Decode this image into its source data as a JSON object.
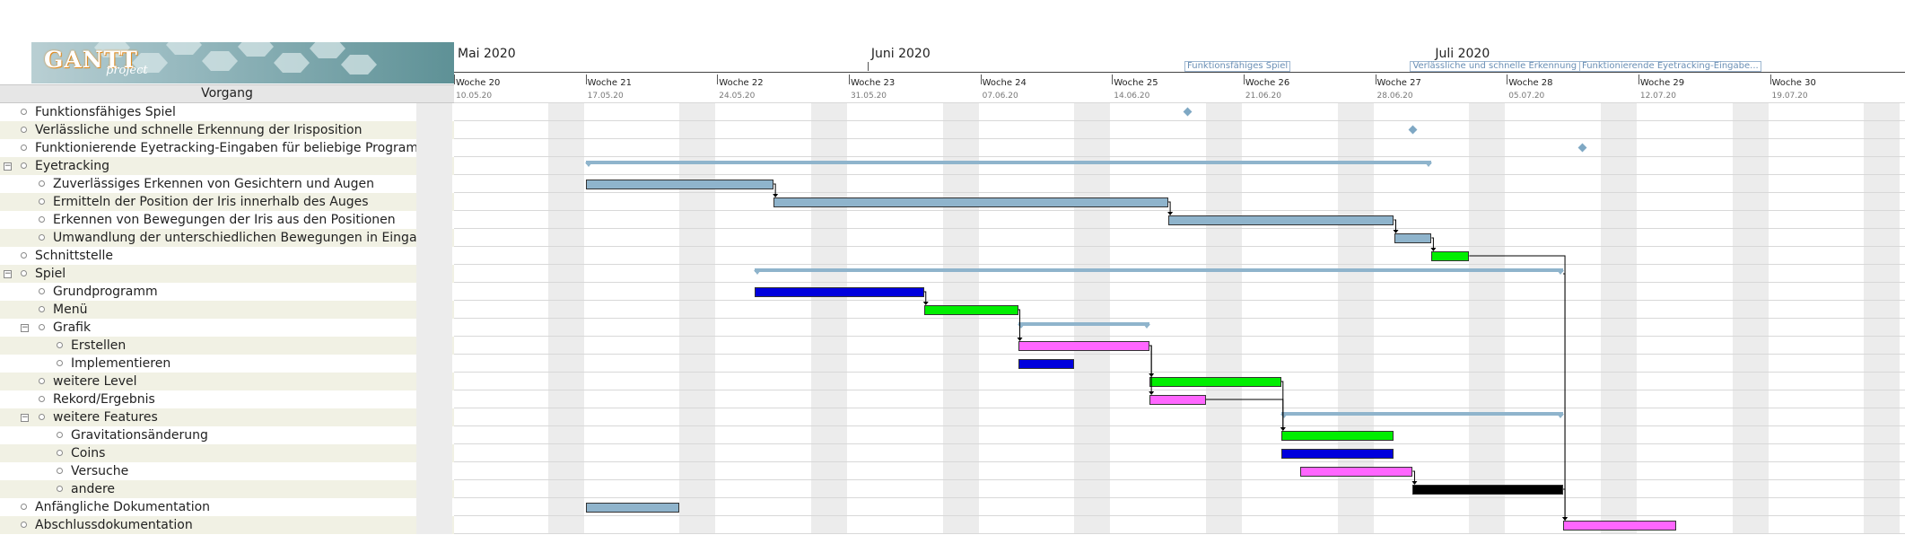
{
  "header": {
    "logo_text": "GANTT",
    "logo_sub": "project",
    "column_title": "Vorgang"
  },
  "months": [
    {
      "label": "Mai 2020"
    },
    {
      "label": "Juni 2020"
    },
    {
      "label": "Juli 2020"
    }
  ],
  "milestone_labels": [
    "Funktionsfähiges Spiel",
    "Verlässliche und schnelle Erkennung ...",
    "Funktionierende Eyetracking-Eingabe..."
  ],
  "weeks": [
    {
      "label": "Woche 20",
      "date": "10.05.20"
    },
    {
      "label": "Woche 21",
      "date": "17.05.20"
    },
    {
      "label": "Woche 22",
      "date": "24.05.20"
    },
    {
      "label": "Woche 23",
      "date": "31.05.20"
    },
    {
      "label": "Woche 24",
      "date": "07.06.20"
    },
    {
      "label": "Woche 25",
      "date": "14.06.20"
    },
    {
      "label": "Woche 26",
      "date": "21.06.20"
    },
    {
      "label": "Woche 27",
      "date": "28.06.20"
    },
    {
      "label": "Woche 28",
      "date": "05.07.20"
    },
    {
      "label": "Woche 29",
      "date": "12.07.20"
    },
    {
      "label": "Woche 30",
      "date": "19.07.20"
    }
  ],
  "tasks": [
    {
      "name": "Funktionsfähiges Spiel",
      "level": 0,
      "expander": "",
      "type": "milestone",
      "start": "2020-06-18",
      "end": "2020-06-18"
    },
    {
      "name": "Verlässliche und schnelle Erkennung der Irisposition",
      "level": 0,
      "expander": "",
      "type": "milestone",
      "start": "2020-06-30",
      "end": "2020-06-30"
    },
    {
      "name": "Funktionierende Eyetracking-Eingaben für beliebige Programme",
      "level": 0,
      "expander": "",
      "type": "milestone",
      "start": "2020-07-09",
      "end": "2020-07-09"
    },
    {
      "name": "Eyetracking",
      "level": 0,
      "expander": "−",
      "type": "summary",
      "start": "2020-05-17",
      "end": "2020-07-01"
    },
    {
      "name": "Zuverlässiges Erkennen von Gesichtern und Augen",
      "level": 1,
      "expander": "",
      "type": "task",
      "start": "2020-05-17",
      "end": "2020-05-27",
      "color": "#8fb4cc"
    },
    {
      "name": "Ermitteln der Position der Iris innerhalb des Auges",
      "level": 1,
      "expander": "",
      "type": "task",
      "start": "2020-05-27",
      "end": "2020-06-17",
      "color": "#8fb4cc"
    },
    {
      "name": "Erkennen von Bewegungen der Iris aus den Positionen",
      "level": 1,
      "expander": "",
      "type": "task",
      "start": "2020-06-17",
      "end": "2020-06-29",
      "color": "#8fb4cc"
    },
    {
      "name": "Umwandlung der unterschiedlichen Bewegungen in Eingaben",
      "level": 1,
      "expander": "",
      "type": "task",
      "start": "2020-06-29",
      "end": "2020-07-01",
      "color": "#8fb4cc"
    },
    {
      "name": "Schnittstelle",
      "level": 0,
      "expander": "",
      "type": "task",
      "start": "2020-07-01",
      "end": "2020-07-03",
      "color": "#00ee00"
    },
    {
      "name": "Spiel",
      "level": 0,
      "expander": "−",
      "type": "summary",
      "start": "2020-05-26",
      "end": "2020-07-08"
    },
    {
      "name": "Grundprogramm",
      "level": 1,
      "expander": "",
      "type": "task",
      "start": "2020-05-26",
      "end": "2020-06-04",
      "color": "#0000dd"
    },
    {
      "name": "Menü",
      "level": 1,
      "expander": "",
      "type": "task",
      "start": "2020-06-04",
      "end": "2020-06-09",
      "color": "#00ee00"
    },
    {
      "name": "Grafik",
      "level": 1,
      "expander": "−",
      "type": "summary",
      "start": "2020-06-09",
      "end": "2020-06-16"
    },
    {
      "name": "Erstellen",
      "level": 2,
      "expander": "",
      "type": "task",
      "start": "2020-06-09",
      "end": "2020-06-16",
      "color": "#ff66ff"
    },
    {
      "name": "Implementieren",
      "level": 2,
      "expander": "",
      "type": "task",
      "start": "2020-06-09",
      "end": "2020-06-12",
      "color": "#0000dd"
    },
    {
      "name": "weitere Level",
      "level": 1,
      "expander": "",
      "type": "task",
      "start": "2020-06-16",
      "end": "2020-06-23",
      "color": "#00ee00"
    },
    {
      "name": "Rekord/Ergebnis",
      "level": 1,
      "expander": "",
      "type": "task",
      "start": "2020-06-16",
      "end": "2020-06-19",
      "color": "#ff66ff"
    },
    {
      "name": "weitere Features",
      "level": 1,
      "expander": "−",
      "type": "summary",
      "start": "2020-06-23",
      "end": "2020-07-08"
    },
    {
      "name": "Gravitationsänderung",
      "level": 2,
      "expander": "",
      "type": "task",
      "start": "2020-06-23",
      "end": "2020-06-29",
      "color": "#00ee00"
    },
    {
      "name": "Coins",
      "level": 2,
      "expander": "",
      "type": "task",
      "start": "2020-06-23",
      "end": "2020-06-29",
      "color": "#0000dd"
    },
    {
      "name": "Versuche",
      "level": 2,
      "expander": "",
      "type": "task",
      "start": "2020-06-24",
      "end": "2020-06-30",
      "color": "#ff66ff"
    },
    {
      "name": "andere",
      "level": 2,
      "expander": "",
      "type": "task",
      "start": "2020-06-30",
      "end": "2020-07-08",
      "color": "#000000"
    },
    {
      "name": "Anfängliche Dokumentation",
      "level": 0,
      "expander": "",
      "type": "task",
      "start": "2020-05-17",
      "end": "2020-05-22",
      "color": "#8fb4cc"
    },
    {
      "name": "Abschlussdokumentation",
      "level": 0,
      "expander": "",
      "type": "task",
      "start": "2020-07-08",
      "end": "2020-07-14",
      "color": "#ff66ff"
    }
  ],
  "dependencies": [
    [
      4,
      5
    ],
    [
      5,
      6
    ],
    [
      6,
      7
    ],
    [
      7,
      8
    ],
    [
      10,
      11
    ],
    [
      11,
      13
    ],
    [
      13,
      15
    ],
    [
      13,
      16
    ],
    [
      15,
      18
    ],
    [
      16,
      18
    ],
    [
      20,
      21
    ],
    [
      8,
      23
    ],
    [
      9,
      23
    ],
    [
      21,
      23
    ]
  ]
}
